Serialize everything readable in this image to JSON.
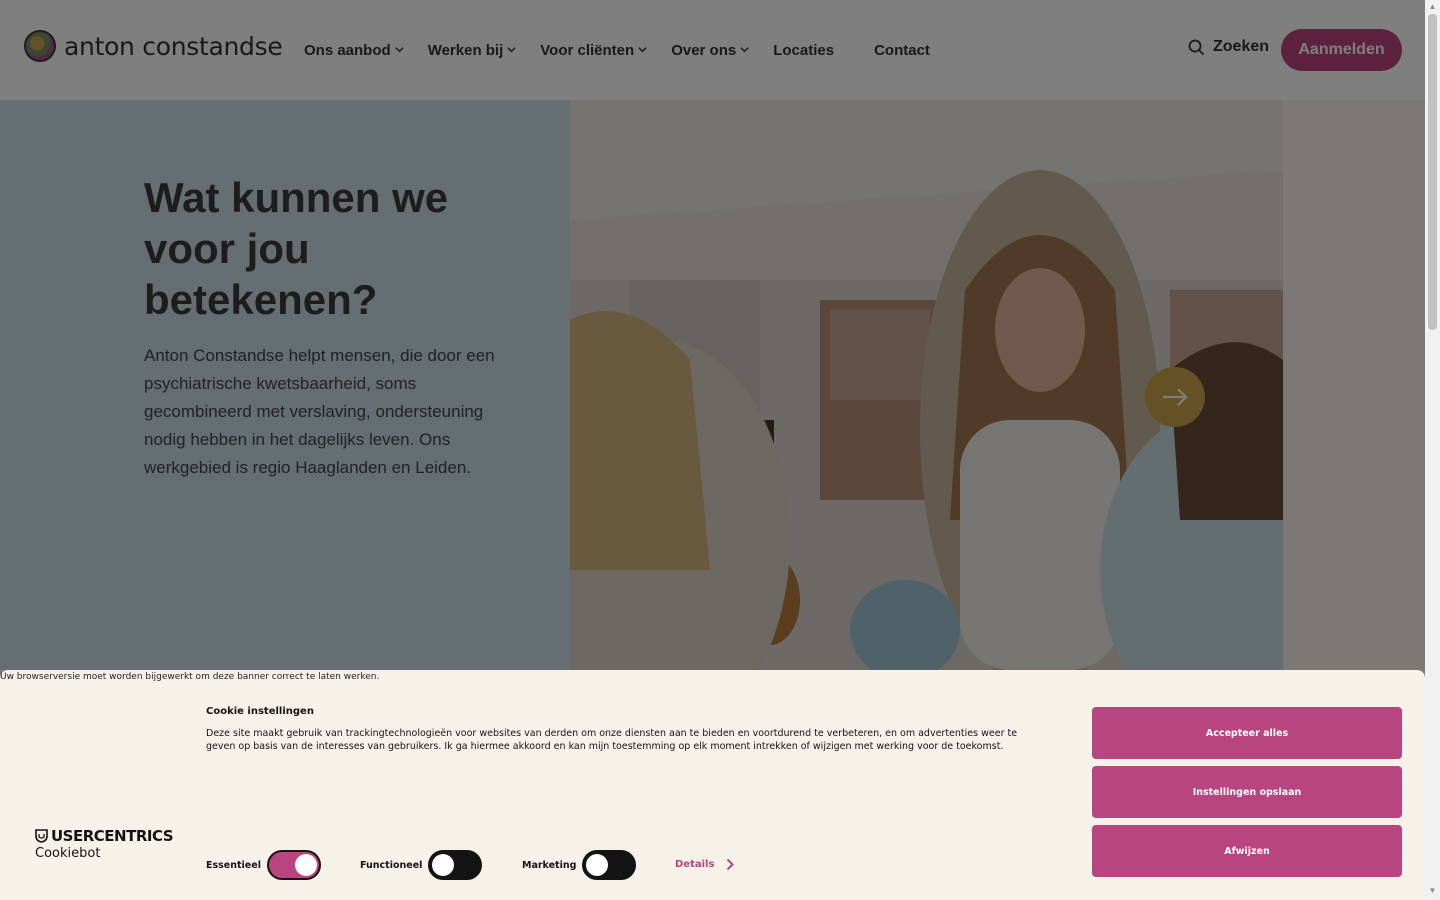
{
  "header": {
    "logo_text": "anton constandse",
    "nav": [
      {
        "label": "Ons aanbod",
        "has_dropdown": true
      },
      {
        "label": "Werken bij",
        "has_dropdown": true
      },
      {
        "label": "Voor cliënten",
        "has_dropdown": true
      },
      {
        "label": "Over ons",
        "has_dropdown": true
      },
      {
        "label": "Locaties",
        "has_dropdown": false
      },
      {
        "label": "Contact",
        "has_dropdown": false
      }
    ],
    "search_label": "Zoeken",
    "login_label": "Aanmelden"
  },
  "hero": {
    "title": "Wat kunnen we voor jou betekenen?",
    "text": "Anton Constandse helpt mensen, die door een psychiatrische kwetsbaarheid, soms gecombineerd met verslaving, ondersteuning nodig hebben in het dagelijks leven. Ons werkgebied is regio Haaglanden en Leiden.",
    "next_icon": "arrow-right-icon"
  },
  "cookie_banner": {
    "browser_warning": "Uw browserversie moet worden bijgewerkt om deze banner correct te laten werken.",
    "title": "Cookie instellingen",
    "body": "Deze site maakt gebruik van trackingtechnologieën voor websites van derden om onze diensten aan te bieden en voortdurend te verbeteren, en om advertenties weer te geven op basis van de interesses van gebruikers. Ik ga hiermee akkoord en kan mijn toestemming op elk moment intrekken of wijzigen met werking voor de toekomst.",
    "brand": "USERCENTRICS",
    "brand_sub": "Cookiebot",
    "toggles": [
      {
        "label": "Essentieel",
        "on": true
      },
      {
        "label": "Functioneel",
        "on": false
      },
      {
        "label": "Marketing",
        "on": false
      }
    ],
    "details_label": "Details",
    "buttons": {
      "accept_all": "Accepteer alles",
      "save": "Instellingen opslaan",
      "reject": "Afwijzen"
    }
  },
  "colors": {
    "brand_magenta": "#b8457f",
    "brand_gold": "#c9a24a",
    "hero_blue": "#c8dde6",
    "banner_bg": "#f6f2ea"
  }
}
